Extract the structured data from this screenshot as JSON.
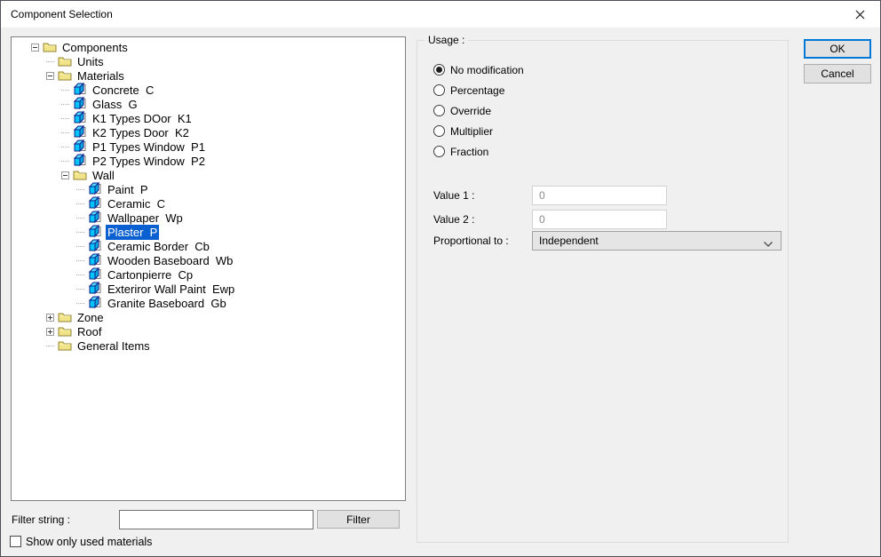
{
  "window": {
    "title": "Component Selection"
  },
  "colors": {
    "selection": "#0a60d0",
    "accent": "#0078d7"
  },
  "tree": {
    "items": [
      {
        "name": "Components",
        "icon": "folder",
        "level": 0,
        "expander": "minus"
      },
      {
        "name": "Units",
        "icon": "folder",
        "level": 1,
        "expander": "none"
      },
      {
        "name": "Materials",
        "icon": "folder",
        "level": 1,
        "expander": "minus"
      },
      {
        "name": "Concrete",
        "code": "C",
        "icon": "material",
        "level": 2,
        "expander": "none"
      },
      {
        "name": "Glass",
        "code": "G",
        "icon": "material",
        "level": 2,
        "expander": "none"
      },
      {
        "name": "K1 Types DOor",
        "code": "K1",
        "icon": "material",
        "level": 2,
        "expander": "none"
      },
      {
        "name": "K2 Types Door",
        "code": "K2",
        "icon": "material",
        "level": 2,
        "expander": "none"
      },
      {
        "name": "P1 Types Window",
        "code": "P1",
        "icon": "material",
        "level": 2,
        "expander": "none"
      },
      {
        "name": "P2 Types Window",
        "code": "P2",
        "icon": "material",
        "level": 2,
        "expander": "none"
      },
      {
        "name": "Wall",
        "icon": "folder",
        "level": 2,
        "expander": "minus"
      },
      {
        "name": "Paint",
        "code": "P",
        "icon": "material",
        "level": 3,
        "expander": "none"
      },
      {
        "name": "Ceramic",
        "code": "C",
        "icon": "material",
        "level": 3,
        "expander": "none"
      },
      {
        "name": "Wallpaper",
        "code": "Wp",
        "icon": "material",
        "level": 3,
        "expander": "none"
      },
      {
        "name": "Plaster",
        "code": "P",
        "icon": "material",
        "level": 3,
        "expander": "none",
        "selected": true
      },
      {
        "name": "Ceramic Border",
        "code": "Cb",
        "icon": "material",
        "level": 3,
        "expander": "none"
      },
      {
        "name": "Wooden Baseboard",
        "code": "Wb",
        "icon": "material",
        "level": 3,
        "expander": "none"
      },
      {
        "name": "Cartonpierre",
        "code": "Cp",
        "icon": "material",
        "level": 3,
        "expander": "none"
      },
      {
        "name": "Exteriror Wall Paint",
        "code": "Ewp",
        "icon": "material",
        "level": 3,
        "expander": "none"
      },
      {
        "name": "Granite Baseboard",
        "code": "Gb",
        "icon": "material",
        "level": 3,
        "expander": "none"
      },
      {
        "name": "Zone",
        "icon": "folder",
        "level": 1,
        "expander": "plus"
      },
      {
        "name": "Roof",
        "icon": "folder",
        "level": 1,
        "expander": "plus"
      },
      {
        "name": "General Items",
        "icon": "folder",
        "level": 1,
        "expander": "none"
      }
    ]
  },
  "usage": {
    "group_label": "Usage :",
    "options": [
      {
        "label": "No modification",
        "selected": true
      },
      {
        "label": "Percentage",
        "selected": false
      },
      {
        "label": "Override",
        "selected": false
      },
      {
        "label": "Multiplier",
        "selected": false
      },
      {
        "label": "Fraction",
        "selected": false
      }
    ]
  },
  "fields": {
    "value1_label": "Value 1 :",
    "value1": "0",
    "value2_label": "Value 2 :",
    "value2": "0",
    "proportional_label": "Proportional to :",
    "proportional_value": "Independent"
  },
  "buttons": {
    "ok": "OK",
    "cancel": "Cancel",
    "filter": "Filter"
  },
  "filter": {
    "label": "Filter string :",
    "value": ""
  },
  "footer": {
    "checkbox_label": "Show only used materials",
    "checkbox_checked": false
  }
}
